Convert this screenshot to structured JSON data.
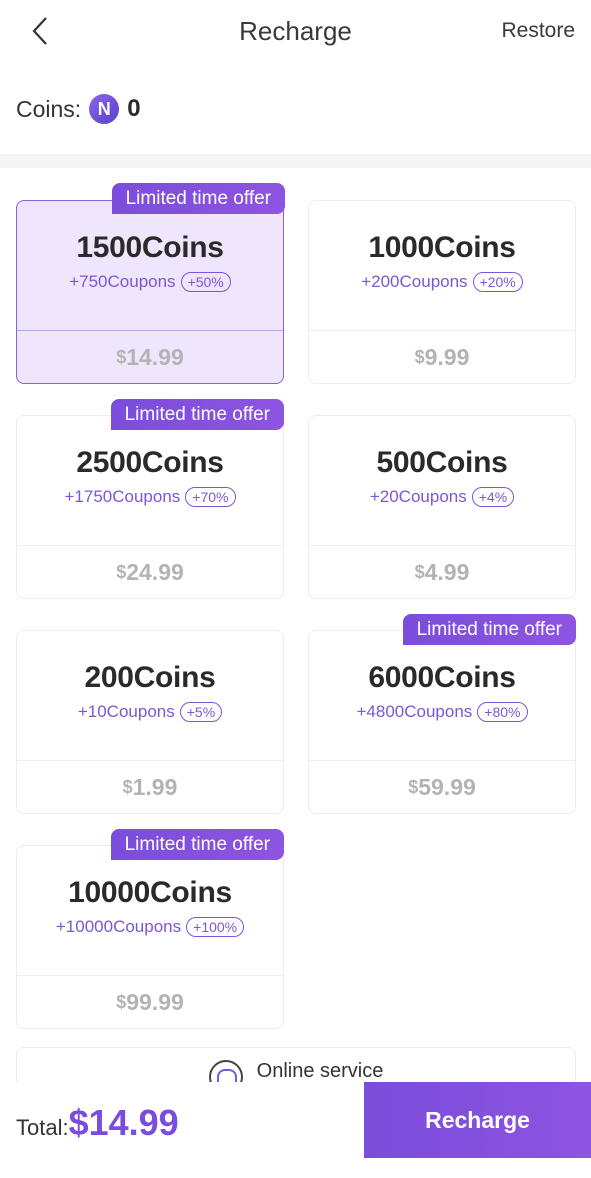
{
  "header": {
    "title": "Recharge",
    "restore_label": "Restore",
    "back_icon": "chevron-left-icon"
  },
  "balance": {
    "label": "Coins:",
    "icon": "coin-icon",
    "icon_glyph": "N",
    "value": "0"
  },
  "packages": [
    {
      "coins": "1500Coins",
      "coupons": "+750Coupons",
      "bonus": "+50%",
      "currency": "$",
      "price": "14.99",
      "badge": "Limited time offer",
      "selected": true
    },
    {
      "coins": "1000Coins",
      "coupons": "+200Coupons",
      "bonus": "+20%",
      "currency": "$",
      "price": "9.99",
      "badge": null,
      "selected": false
    },
    {
      "coins": "2500Coins",
      "coupons": "+1750Coupons",
      "bonus": "+70%",
      "currency": "$",
      "price": "24.99",
      "badge": "Limited time offer",
      "selected": false
    },
    {
      "coins": "500Coins",
      "coupons": "+20Coupons",
      "bonus": "+4%",
      "currency": "$",
      "price": "4.99",
      "badge": null,
      "selected": false
    },
    {
      "coins": "200Coins",
      "coupons": "+10Coupons",
      "bonus": "+5%",
      "currency": "$",
      "price": "1.99",
      "badge": null,
      "selected": false
    },
    {
      "coins": "6000Coins",
      "coupons": "+4800Coupons",
      "bonus": "+80%",
      "currency": "$",
      "price": "59.99",
      "badge": "Limited time offer",
      "selected": false
    },
    {
      "coins": "10000Coins",
      "coupons": "+10000Coupons",
      "bonus": "+100%",
      "currency": "$",
      "price": "99.99",
      "badge": "Limited time offer",
      "selected": false
    }
  ],
  "service": {
    "label": "Online service",
    "icon": "headset-icon"
  },
  "footer": {
    "total_label": "Total:",
    "total_value": "$14.99",
    "button_label": "Recharge"
  },
  "colors": {
    "accent": "#7b4ddc",
    "selected_bg": "#efe6fd",
    "price_gray": "#b3b3b3"
  }
}
